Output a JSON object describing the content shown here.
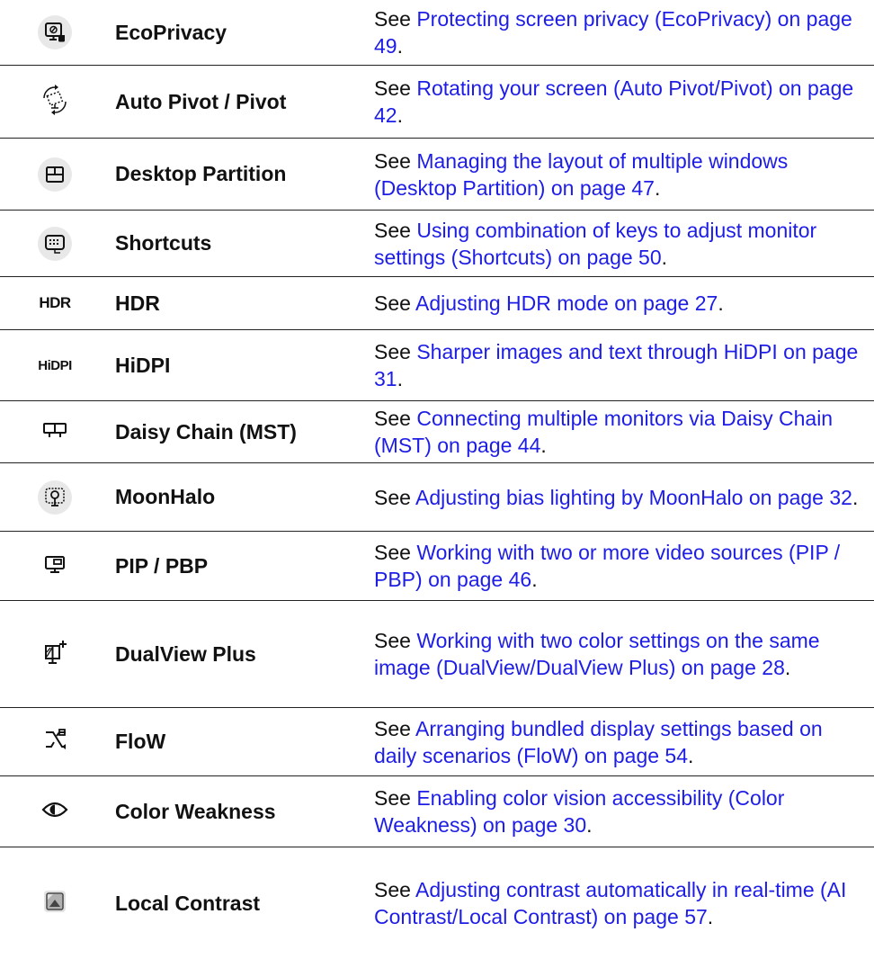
{
  "rows": [
    {
      "icon": "eco-privacy-icon",
      "name": "EcoPrivacy",
      "prefix": "See ",
      "link": "Protecting screen privacy (EcoPrivacy) on page 49",
      "suffix": "."
    },
    {
      "icon": "auto-pivot-icon",
      "name": "Auto Pivot / Pivot",
      "prefix": "See ",
      "link": "Rotating your screen (Auto Pivot/Pivot) on page 42",
      "suffix": "."
    },
    {
      "icon": "desktop-partition-icon",
      "name": "Desktop Partition",
      "prefix": "See ",
      "link": "Managing the layout of multiple windows (Desktop Partition) on page 47",
      "suffix": "."
    },
    {
      "icon": "shortcuts-icon",
      "name": "Shortcuts",
      "prefix": "See ",
      "link": "Using combination of keys to adjust monitor settings (Shortcuts) on page 50",
      "suffix": "."
    },
    {
      "icon": "hdr-icon",
      "icon_text": "HDR",
      "name": "HDR",
      "prefix": "See ",
      "link": "Adjusting HDR mode on page 27",
      "suffix": "."
    },
    {
      "icon": "hidpi-icon",
      "icon_text": "HiDPI",
      "name": "HiDPI",
      "prefix": "See ",
      "link": "Sharper images and text through HiDPI on page 31",
      "suffix": "."
    },
    {
      "icon": "daisy-chain-icon",
      "name": "Daisy Chain (MST)",
      "prefix": "See ",
      "link": "Connecting multiple monitors via Daisy Chain (MST) on page 44",
      "suffix": "."
    },
    {
      "icon": "moonhalo-icon",
      "name": "MoonHalo",
      "prefix": "See ",
      "link": "Adjusting bias lighting by MoonHalo on page 32",
      "suffix": "."
    },
    {
      "icon": "pip-pbp-icon",
      "name": "PIP / PBP",
      "prefix": "See ",
      "link": "Working with two or more video sources (PIP / PBP) on page 46",
      "suffix": "."
    },
    {
      "icon": "dualview-plus-icon",
      "name": "DualView Plus",
      "prefix": "See ",
      "link": "Working with two color settings on the same image (DualView/DualView Plus) on page 28",
      "suffix": "."
    },
    {
      "icon": "flow-icon",
      "name": "FloW",
      "prefix": "See ",
      "link": "Arranging bundled display settings based on daily scenarios (FloW) on page 54",
      "suffix": "."
    },
    {
      "icon": "color-weakness-icon",
      "name": "Color Weakness",
      "prefix": "See ",
      "link": "Enabling color vision accessibility (Color Weakness) on page 30",
      "suffix": "."
    },
    {
      "icon": "local-contrast-icon",
      "name": "Local Contrast",
      "prefix": "See ",
      "link": "Adjusting contrast automatically in real-time (AI Contrast/Local Contrast) on page 57",
      "suffix": "."
    }
  ],
  "colors": {
    "link": "#1d1de6",
    "text": "#111111",
    "rule": "#222222",
    "badge": "#e8e8e8"
  }
}
